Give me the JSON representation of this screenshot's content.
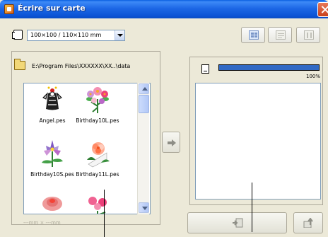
{
  "window": {
    "title": "Écrire sur carte"
  },
  "toolbar": {
    "size_value": "100×100 / 110×110 mm",
    "buttons": [
      {
        "name": "layout-button",
        "enabled": true
      },
      {
        "name": "import-button",
        "enabled": false
      },
      {
        "name": "view-button",
        "enabled": false
      }
    ]
  },
  "source": {
    "path": "E:\\Program Files\\XXXXXX\\XX..\\data",
    "items": [
      {
        "label": "Angel.pes"
      },
      {
        "label": "Birthday10L.pes"
      },
      {
        "label": "Birthday10S.pes"
      },
      {
        "label": "Birthday11L.pes"
      }
    ],
    "dimensions": "---mm × ---mm"
  },
  "card": {
    "progress_percent": 100,
    "progress_label": "100%"
  },
  "colors": {
    "titlebar": "#0b54d6",
    "window_bg": "#ece9d8",
    "progress_fill": "#316ac5"
  }
}
